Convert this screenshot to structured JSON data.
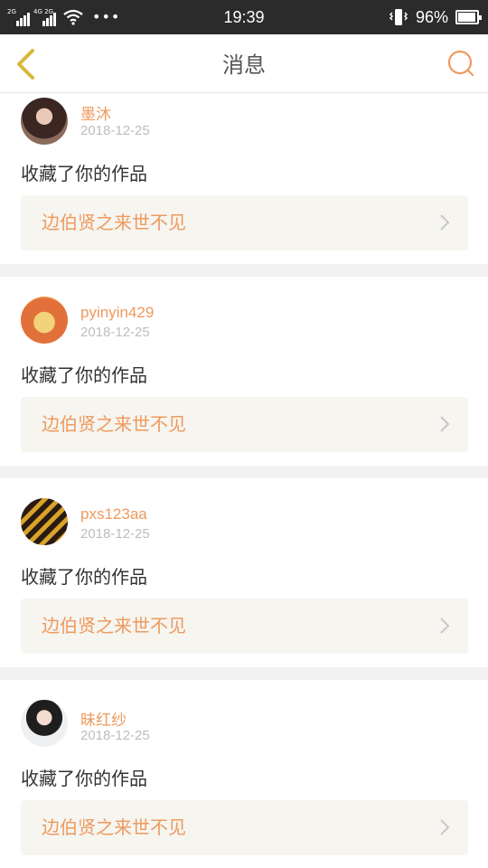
{
  "status_bar": {
    "net_top": "2G",
    "net_bottom": "4G 2G",
    "time": "19:39",
    "battery_pct": "96%",
    "battery_level": 0.96
  },
  "header": {
    "title": "消息",
    "back_icon": "chevron-left-icon",
    "search_icon": "search-icon"
  },
  "colors": {
    "accent": "#ee9a5e",
    "back_arrow": "#d9b83a",
    "card_bg": "#f6f5f0",
    "separator": "#f2f2f2"
  },
  "messages": [
    {
      "username": "墨沐",
      "date": "2018-12-25",
      "action": "收藏了你的作品",
      "work_title": "边伯贤之来世不见"
    },
    {
      "username": "pyinyin429",
      "date": "2018-12-25",
      "action": "收藏了你的作品",
      "work_title": "边伯贤之来世不见"
    },
    {
      "username": "pxs123aa",
      "date": "2018-12-25",
      "action": "收藏了你的作品",
      "work_title": "边伯贤之来世不见"
    },
    {
      "username": "昧红纱",
      "date": "2018-12-25",
      "action": "收藏了你的作品",
      "work_title": "边伯贤之来世不见"
    }
  ]
}
